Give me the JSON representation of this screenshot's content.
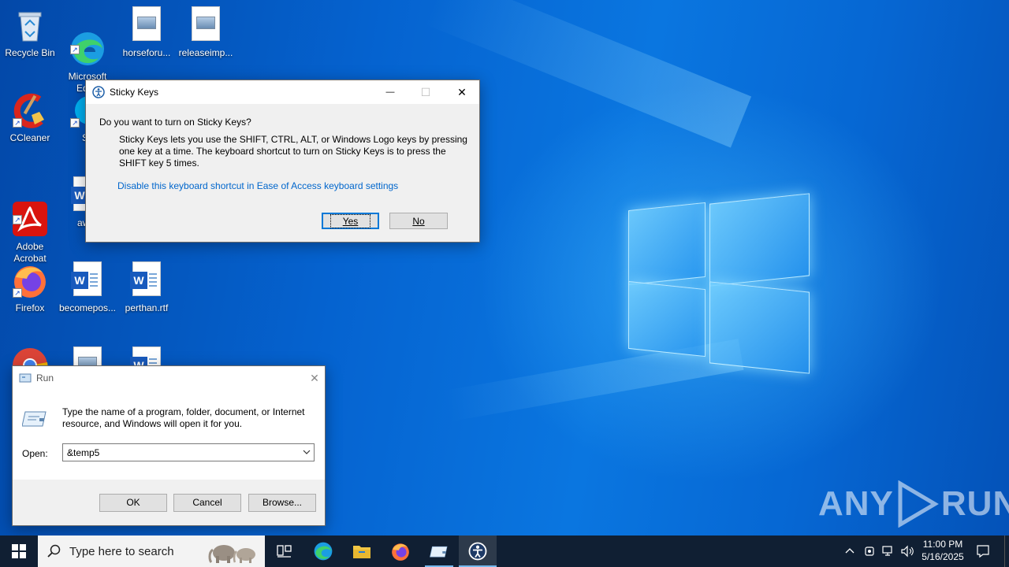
{
  "desktop": {
    "icons": [
      {
        "label": "Recycle Bin",
        "icon": "recycle-bin-icon"
      },
      {
        "label": "Microsoft\nEdge",
        "icon": "edge-icon"
      },
      {
        "label": "horseforu...",
        "icon": "image-file-icon"
      },
      {
        "label": "releaseimp...",
        "icon": "image-file-icon"
      },
      {
        "label": "CCleaner",
        "icon": "ccleaner-icon"
      },
      {
        "label": "Sk",
        "icon": "skype-icon"
      },
      {
        "label": "Adobe\nAcrobat",
        "icon": "acrobat-icon"
      },
      {
        "label": "awar",
        "icon": "word-doc-icon"
      },
      {
        "label": "Firefox",
        "icon": "firefox-icon"
      },
      {
        "label": "becomepos...",
        "icon": "word-doc-icon"
      },
      {
        "label": "perthan.rtf",
        "icon": "word-doc-icon"
      }
    ],
    "watermark": {
      "text_left": "ANY",
      "text_right": "RUN"
    }
  },
  "sticky_keys": {
    "title": "Sticky Keys",
    "question": "Do you want to turn on Sticky Keys?",
    "description": "Sticky Keys lets you use the SHIFT, CTRL, ALT, or Windows Logo keys by pressing one key at a time. The keyboard shortcut to turn on Sticky Keys is to press the SHIFT key 5 times.",
    "link": "Disable this keyboard shortcut in Ease of Access keyboard settings",
    "yes_label": "Yes",
    "no_label": "No",
    "minimize": "—",
    "maximize": "☐",
    "close": "✕"
  },
  "run_dialog": {
    "title": "Run",
    "description": "Type the name of a program, folder, document, or Internet resource, and Windows will open it for you.",
    "open_label": "Open:",
    "open_value": "&temp5",
    "ok_label": "OK",
    "cancel_label": "Cancel",
    "browse_label": "Browse...",
    "close": "✕"
  },
  "taskbar": {
    "search_placeholder": "Type here to search",
    "time": "11:00 PM",
    "date": "5/16/2025",
    "accent": "#76b9ed"
  }
}
